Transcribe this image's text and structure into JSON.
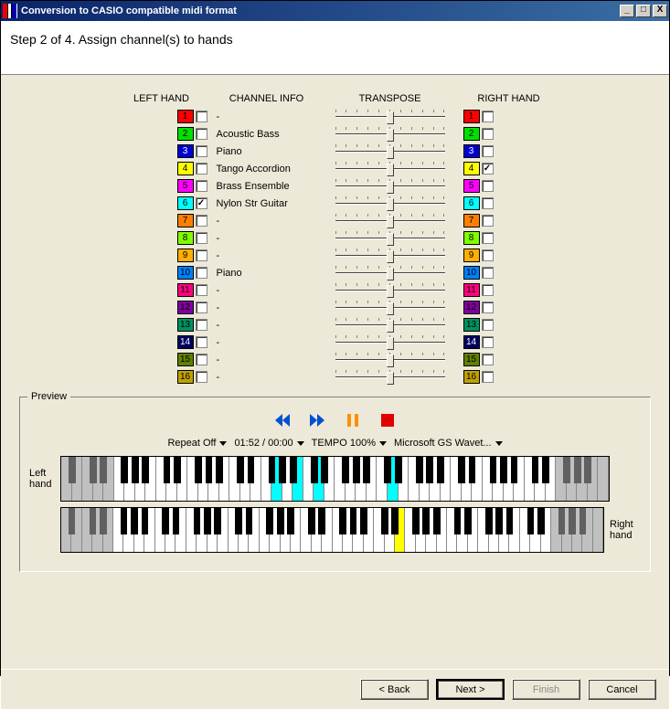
{
  "window": {
    "title": "Conversion to CASIO compatible midi format",
    "minimize": "_",
    "maximize": "□",
    "close": "X"
  },
  "instruction": "Step 2 of 4. Assign channel(s) to hands",
  "headers": {
    "left": "LEFT HAND",
    "info": "CHANNEL INFO",
    "transpose": "TRANSPOSE",
    "right": "RIGHT HAND"
  },
  "channels": [
    {
      "n": "1",
      "color": "#ff0000",
      "info": "-",
      "left": false,
      "right": false
    },
    {
      "n": "2",
      "color": "#00e000",
      "info": "Acoustic Bass",
      "left": false,
      "right": false
    },
    {
      "n": "3",
      "color": "#0000d0",
      "textcolor": "#fff",
      "info": "Piano",
      "left": false,
      "right": false
    },
    {
      "n": "4",
      "color": "#ffff00",
      "info": "Tango Accordion",
      "left": false,
      "right": true
    },
    {
      "n": "5",
      "color": "#ff00ff",
      "info": "Brass Ensemble",
      "left": false,
      "right": false
    },
    {
      "n": "6",
      "color": "#00ffff",
      "info": "Nylon Str Guitar",
      "left": true,
      "right": false
    },
    {
      "n": "7",
      "color": "#ff8000",
      "info": "-",
      "left": false,
      "right": false
    },
    {
      "n": "8",
      "color": "#80ff00",
      "info": "-",
      "left": false,
      "right": false
    },
    {
      "n": "9",
      "color": "#ffb000",
      "info": "-",
      "left": false,
      "right": false
    },
    {
      "n": "10",
      "color": "#0080ff",
      "info": "Piano",
      "left": false,
      "right": false
    },
    {
      "n": "11",
      "color": "#ff0080",
      "info": "-",
      "left": false,
      "right": false
    },
    {
      "n": "12",
      "color": "#8000a0",
      "textcolor": "#000",
      "info": "-",
      "left": false,
      "right": false
    },
    {
      "n": "13",
      "color": "#009060",
      "info": "-",
      "left": false,
      "right": false
    },
    {
      "n": "14",
      "color": "#000060",
      "textcolor": "#fff",
      "info": "-",
      "left": false,
      "right": false
    },
    {
      "n": "15",
      "color": "#608000",
      "info": "-",
      "left": false,
      "right": false
    },
    {
      "n": "16",
      "color": "#c0a000",
      "info": "-",
      "left": false,
      "right": false
    }
  ],
  "preview": {
    "legend": "Preview",
    "labels": {
      "left": "Left hand",
      "right": "Right hand"
    },
    "status": {
      "repeat": "Repeat Off",
      "time": "01:52 / 00:00",
      "tempo": "TEMPO 100%",
      "device": "Microsoft GS Wavet..."
    },
    "left_highlights_white": [
      20,
      22,
      24,
      31
    ],
    "left_highlights_black": [],
    "right_highlights_white": [
      32
    ]
  },
  "buttons": {
    "back": "< Back",
    "next": "Next >",
    "finish": "Finish",
    "cancel": "Cancel"
  }
}
